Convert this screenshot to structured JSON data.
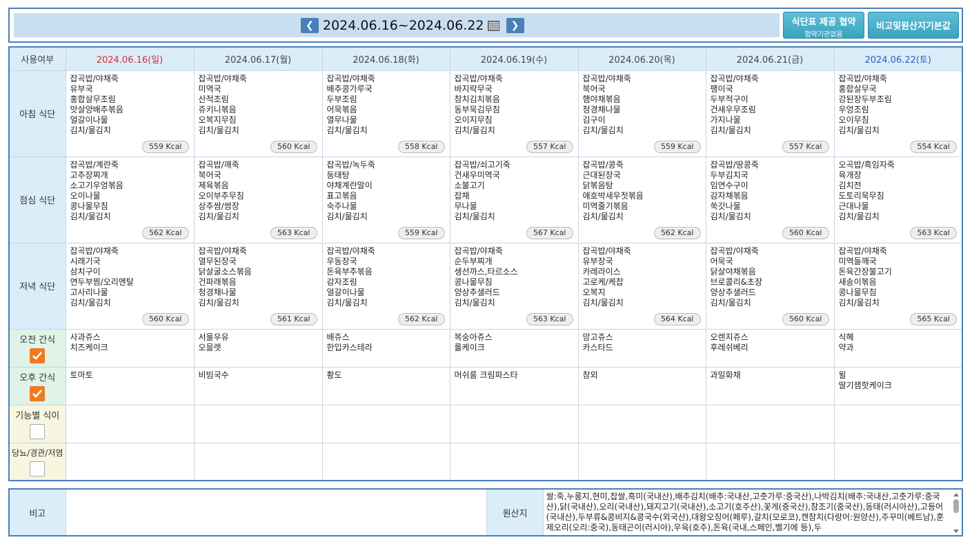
{
  "header": {
    "date_range": "2024.06.16~2024.06.22",
    "prev_label": "<",
    "next_label": ">",
    "btn_agreement_line1": "식단표 제공 협약",
    "btn_agreement_line2": "협약기관없음",
    "btn_remarks": "비고및원산지기본값"
  },
  "table": {
    "corner_label": "사용여부",
    "days": [
      "2024.06.16(일)",
      "2024.06.17(월)",
      "2024.06.18(화)",
      "2024.06.19(수)",
      "2024.06.20(목)",
      "2024.06.21(금)",
      "2024.06.22(토)"
    ],
    "rows": {
      "breakfast": "아침 식단",
      "lunch": "점심 식단",
      "dinner": "저녁 식단",
      "am_snack": "오전 간식",
      "pm_snack": "오후 간식",
      "functional": "기능별 식이",
      "diabetes": "당뇨/경관/저염"
    },
    "checkboxes": {
      "am_snack": true,
      "pm_snack": true,
      "functional": false,
      "diabetes": false
    },
    "breakfast": [
      {
        "items": [
          "잡곡밥/야채죽",
          "유부국",
          "홍합살무조림",
          "맛살양배추볶음",
          "얼갈이나물",
          "김치/물김치"
        ],
        "kcal": "559 Kcal"
      },
      {
        "items": [
          "잡곡밥/야채죽",
          "미역국",
          "산적조림",
          "쥬키니볶음",
          "오복지무침",
          "김치/물김치"
        ],
        "kcal": "560 Kcal"
      },
      {
        "items": [
          "잡곡밥/야채죽",
          "배추콩가루국",
          "두부조림",
          "어묵볶음",
          "열무나물",
          "김치/물김치"
        ],
        "kcal": "558 Kcal"
      },
      {
        "items": [
          "잡곡밥/야채죽",
          "바지락무국",
          "참치김치볶음",
          "동부묵김무침",
          "오이지무침",
          "김치/물김치"
        ],
        "kcal": "557 Kcal"
      },
      {
        "items": [
          "잡곡밥/야채죽",
          "북어국",
          "햄야채볶음",
          "청경채나물",
          "김구이",
          "김치/물김치"
        ],
        "kcal": "559 Kcal"
      },
      {
        "items": [
          "잡곡밥/야채죽",
          "팽이국",
          "두부적구이",
          "건새우무조림",
          "가지나물",
          "김치/물김치"
        ],
        "kcal": "557 Kcal"
      },
      {
        "items": [
          "잡곡밥/야채죽",
          "홍합살무국",
          "강된장두부조림",
          "우엉조림",
          "오이무침",
          "김치/물김치"
        ],
        "kcal": "554 Kcal"
      }
    ],
    "lunch": [
      {
        "items": [
          "잡곡밥/계란죽",
          "고추장찌개",
          "소고기우엉볶음",
          "오이나물",
          "콩나물무침",
          "김치/물김치"
        ],
        "kcal": "562 Kcal"
      },
      {
        "items": [
          "잡곡밥/깨죽",
          "북어국",
          "제육볶음",
          "오이부추무침",
          "상추쌈/쌈장",
          "김치/물김치"
        ],
        "kcal": "563 Kcal"
      },
      {
        "items": [
          "잡곡밥/녹두죽",
          "동태탕",
          "야채계란말이",
          "표고볶음",
          "숙주나물",
          "김치/물김치"
        ],
        "kcal": "559 Kcal"
      },
      {
        "items": [
          "잡곡밥/쇠고기죽",
          "건새우미역국",
          "소불고기",
          "잡채",
          "무나물",
          "김치/물김치"
        ],
        "kcal": "567 Kcal"
      },
      {
        "items": [
          "잡곡밥/콩죽",
          "근대된장국",
          "닭볶음탕",
          "애호박새우젓볶음",
          "미역줄기볶음",
          "김치/물김치"
        ],
        "kcal": "562 Kcal"
      },
      {
        "items": [
          "잡곡밥/땅콩죽",
          "두부김치국",
          "임연수구이",
          "감자채볶음",
          "쑥갓나물",
          "김치/물김치"
        ],
        "kcal": "560 Kcal"
      },
      {
        "items": [
          "오곡밥/흑임자죽",
          "육개장",
          "김치전",
          "도토리묵무침",
          "근대나물",
          "김치/물김치"
        ],
        "kcal": "563 Kcal"
      }
    ],
    "dinner": [
      {
        "items": [
          "잡곡밥/야채죽",
          "시래기국",
          "삼치구이",
          "연두부찜/오리엔탈",
          "고사리나물",
          "김치/물김치"
        ],
        "kcal": "560 Kcal"
      },
      {
        "items": [
          "잡곡밥/야채죽",
          "열무된장국",
          "닭살굴소스볶음",
          "건파래볶음",
          "청경채나물",
          "김치/물김치"
        ],
        "kcal": "561 Kcal"
      },
      {
        "items": [
          "잡곡밥/야채죽",
          "우동장국",
          "돈육부추볶음",
          "감자조림",
          "얼갈이나물",
          "김치/물김치"
        ],
        "kcal": "562 Kcal"
      },
      {
        "items": [
          "잡곡밥/야채죽",
          "순두부찌개",
          "생선까스,타르소스",
          "콩나물무침",
          "양상추샐러드",
          "김치/물김치"
        ],
        "kcal": "563 Kcal"
      },
      {
        "items": [
          "잡곡밥/야채죽",
          "유부장국",
          "카레라이스",
          "고로케/케찹",
          "오복지",
          "김치/물김치"
        ],
        "kcal": "564 Kcal"
      },
      {
        "items": [
          "잡곡밥/야채죽",
          "어묵국",
          "닭살야채볶음",
          "브로콜리&초장",
          "양상추샐러드",
          "김치/물김치"
        ],
        "kcal": "560 Kcal"
      },
      {
        "items": [
          "잡곡밥/야채죽",
          "미역들깨국",
          "돈육간장불고기",
          "새송이볶음",
          "콩나물무침",
          "김치/물김치"
        ],
        "kcal": "565 Kcal"
      }
    ],
    "am_snack": [
      [
        "사과쥬스",
        "치즈케이크"
      ],
      [
        "서울우유",
        "오믈렛"
      ],
      [
        "배쥬스",
        "한입카스테라"
      ],
      [
        "복숭아쥬스",
        "롤케이크"
      ],
      [
        "망고쥬스",
        "카스타드"
      ],
      [
        "오렌지쥬스",
        "후레쉬베리"
      ],
      [
        "식혜",
        "약과"
      ]
    ],
    "pm_snack": [
      [
        "토마토"
      ],
      [
        "비빔국수"
      ],
      [
        "황도"
      ],
      [
        "머쉬룸 크림파스타"
      ],
      [
        "참외"
      ],
      [
        "과일화채"
      ],
      [
        "윌",
        "딸기잼핫케이크"
      ]
    ]
  },
  "bottom": {
    "remarks_label": "비고",
    "remarks_value": "",
    "origin_label": "원산지",
    "origin_text": "쌀:죽,누룽지,현미,찹쌀,흑미(국내산),배추김치(배추:국내산,고춧가루:중국산),나박김치(배추:국내산,고춧가루:중국산),닭(국내산),오리(국내산),돼지고기(국내산),소고기(호주산),꽃게(중국산),참조기(중국산),동태(러시아산),고등어(국내산),두부류&콩비지&콩국수(외국산),대왕오징어(페루),갈치(모로코),캔참치(다랑어:원양산),주꾸미(베트남),훈제오리(오리:중국),동태곤이(러시아),우육(호주),돈육(국내,스페인,벨기에 등),두"
  }
}
